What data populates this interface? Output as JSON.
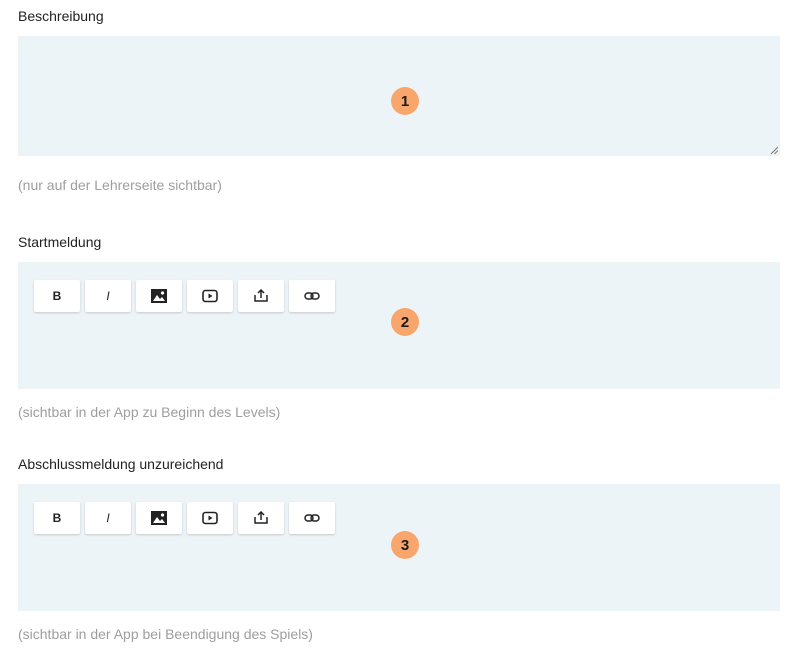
{
  "sections": [
    {
      "label": "Beschreibung",
      "hint": "(nur auf der Lehrerseite sichtbar)",
      "badge": "1"
    },
    {
      "label": "Startmeldung",
      "hint": "(sichtbar in der App zu Beginn des Levels)",
      "badge": "2",
      "toolbar": [
        "B",
        "I",
        "image-icon",
        "video-icon",
        "upload-icon",
        "link-icon"
      ]
    },
    {
      "label": "Abschlussmeldung unzureichend",
      "hint": "(sichtbar in der App bei Beendigung des Spiels)",
      "badge": "3",
      "toolbar": [
        "B",
        "I",
        "image-icon",
        "video-icon",
        "upload-icon",
        "link-icon"
      ]
    }
  ],
  "toolbar": {
    "bold_label": "B",
    "italic_label": "I"
  },
  "colors": {
    "field_bg": "#edf4f8",
    "badge": "#f9a66c",
    "hint": "#9e9e9e"
  }
}
